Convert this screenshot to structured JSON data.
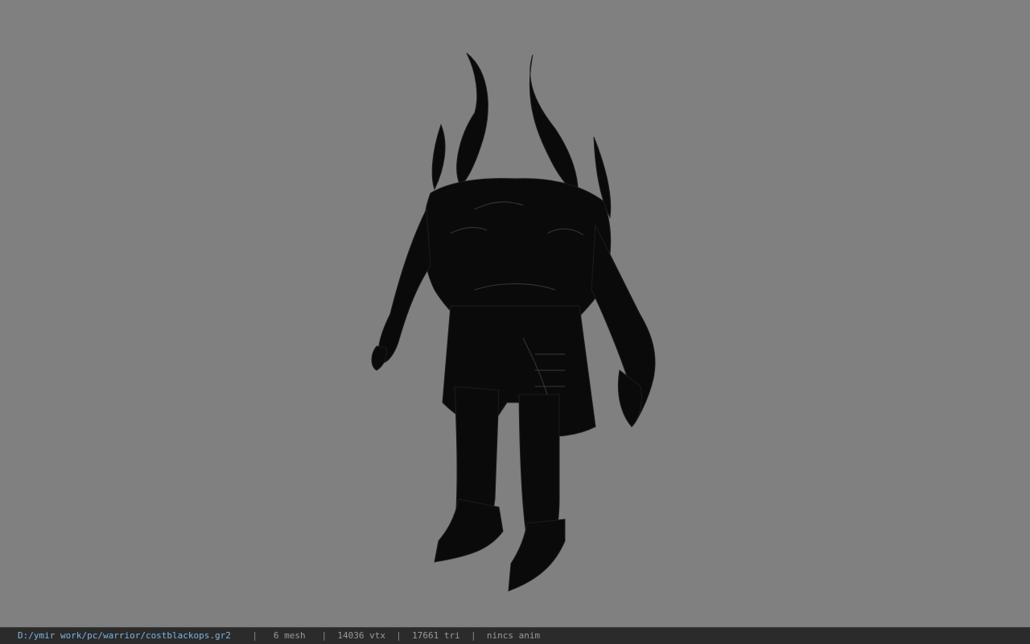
{
  "viewport": {
    "background_color": "#808080",
    "model_color": "#0b0b0b",
    "model_subject": "horned dark armored warrior (costblackops)"
  },
  "statusbar": {
    "file_path": "D:/ymir work/pc/warrior/costblackops.gr2",
    "separator": "|",
    "mesh": "6 mesh",
    "vertices": "14036 vtx",
    "triangles": "17661 tri",
    "animation": "nincs anim",
    "path_color": "#7fb4e0"
  }
}
